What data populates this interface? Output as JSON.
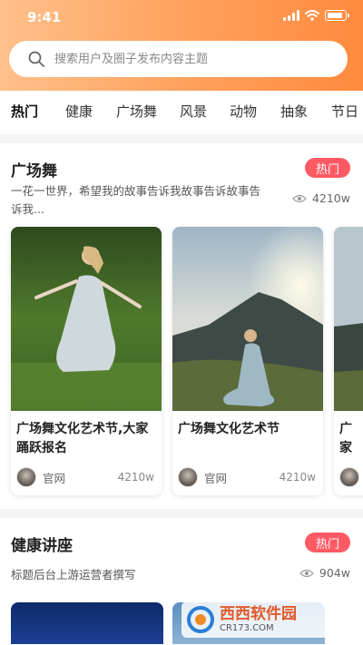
{
  "status_bar": {
    "time": "9:41"
  },
  "search": {
    "placeholder": "搜索用户及圈子发布内容主题"
  },
  "tabs": [
    {
      "label": "热门",
      "active": true
    },
    {
      "label": "健康"
    },
    {
      "label": "广场舞"
    },
    {
      "label": "风景"
    },
    {
      "label": "动物"
    },
    {
      "label": "抽象"
    },
    {
      "label": "节日"
    }
  ],
  "sections": [
    {
      "title": "广场舞",
      "badge": "热门",
      "description": "一花一世界，希望我的故事告诉我故事告诉故事告诉我...",
      "views": "4210w",
      "cards": [
        {
          "title": "广场舞文化艺术节,大家踊跃报名",
          "author": "官网",
          "views": "4210w"
        },
        {
          "title": "广场舞文化艺术节",
          "author": "官网",
          "views": "4210w"
        },
        {
          "title": "广家",
          "author": ""
        }
      ]
    },
    {
      "title": "健康讲座",
      "badge": "热门",
      "description": "标题后台上游运营者撰写",
      "views": "904w"
    }
  ],
  "watermark": {
    "name": "西西软件园",
    "sub": "CR173.COM"
  },
  "colors": {
    "accent": "#ff8a3d",
    "badge": "#ff5a64",
    "highlight": "#ffb27a"
  }
}
